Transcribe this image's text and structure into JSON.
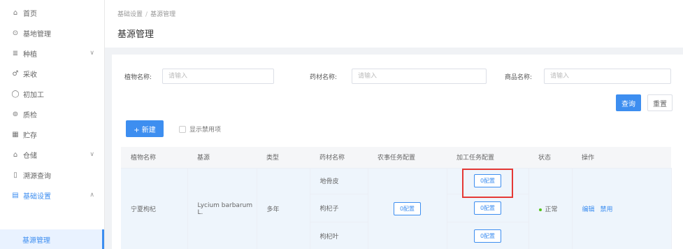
{
  "sidebar": {
    "items": [
      {
        "icon": "⌂",
        "icon_name": "home-icon",
        "label": "首页"
      },
      {
        "icon": "⊙",
        "icon_name": "base-icon",
        "label": "基地管理"
      },
      {
        "icon": "≣",
        "icon_name": "plant-icon",
        "label": "种植",
        "chevron": "∨"
      },
      {
        "icon": "♂",
        "icon_name": "harvest-icon",
        "label": "采收"
      },
      {
        "icon": "◯",
        "icon_name": "process-icon",
        "label": "初加工"
      },
      {
        "icon": "⊚",
        "icon_name": "inspect-icon",
        "label": "质检"
      },
      {
        "icon": "▦",
        "icon_name": "storage-icon",
        "label": "贮存"
      },
      {
        "icon": "⌂",
        "icon_name": "warehouse-icon",
        "label": "仓储",
        "chevron": "∨"
      },
      {
        "icon": "▯",
        "icon_name": "trace-icon",
        "label": "溯源查询"
      },
      {
        "icon": "▤",
        "icon_name": "settings-icon",
        "label": "基础设置",
        "chevron": "∧"
      },
      {
        "icon": "",
        "icon_name": "",
        "label": "基源管理"
      }
    ]
  },
  "breadcrumb": {
    "parent": "基础设置",
    "separator": "/",
    "current": "基源管理"
  },
  "page_title": "基源管理",
  "filters": {
    "plant": {
      "label": "植物名称:",
      "placeholder": "请输入"
    },
    "herb": {
      "label": "药材名称:",
      "placeholder": "请输入"
    },
    "product": {
      "label": "商品名称:",
      "placeholder": "请输入"
    }
  },
  "buttons": {
    "query": "查询",
    "reset": "重置",
    "create": "+ 新建",
    "show_disabled": "显示禁用项"
  },
  "table": {
    "headers": [
      "植物名称",
      "基源",
      "类型",
      "药材名称",
      "农事任务配置",
      "加工任务配置",
      "状态",
      "操作"
    ],
    "row": {
      "plant_name": "宁夏枸杞",
      "origin": "Lycium barbarum L.",
      "type": "多年",
      "herbs": [
        {
          "name": "地骨皮",
          "process_config": "0配置"
        },
        {
          "name": "枸杞子",
          "process_config": "0配置"
        },
        {
          "name": "枸杞叶",
          "process_config": "0配置"
        }
      ],
      "farm_config": "0配置",
      "status": "正常",
      "actions": {
        "edit": "编辑",
        "disable": "禁用"
      }
    }
  },
  "colors": {
    "primary": "#3d8ef0",
    "highlight": "#e53935",
    "status_ok": "#52c41a"
  }
}
